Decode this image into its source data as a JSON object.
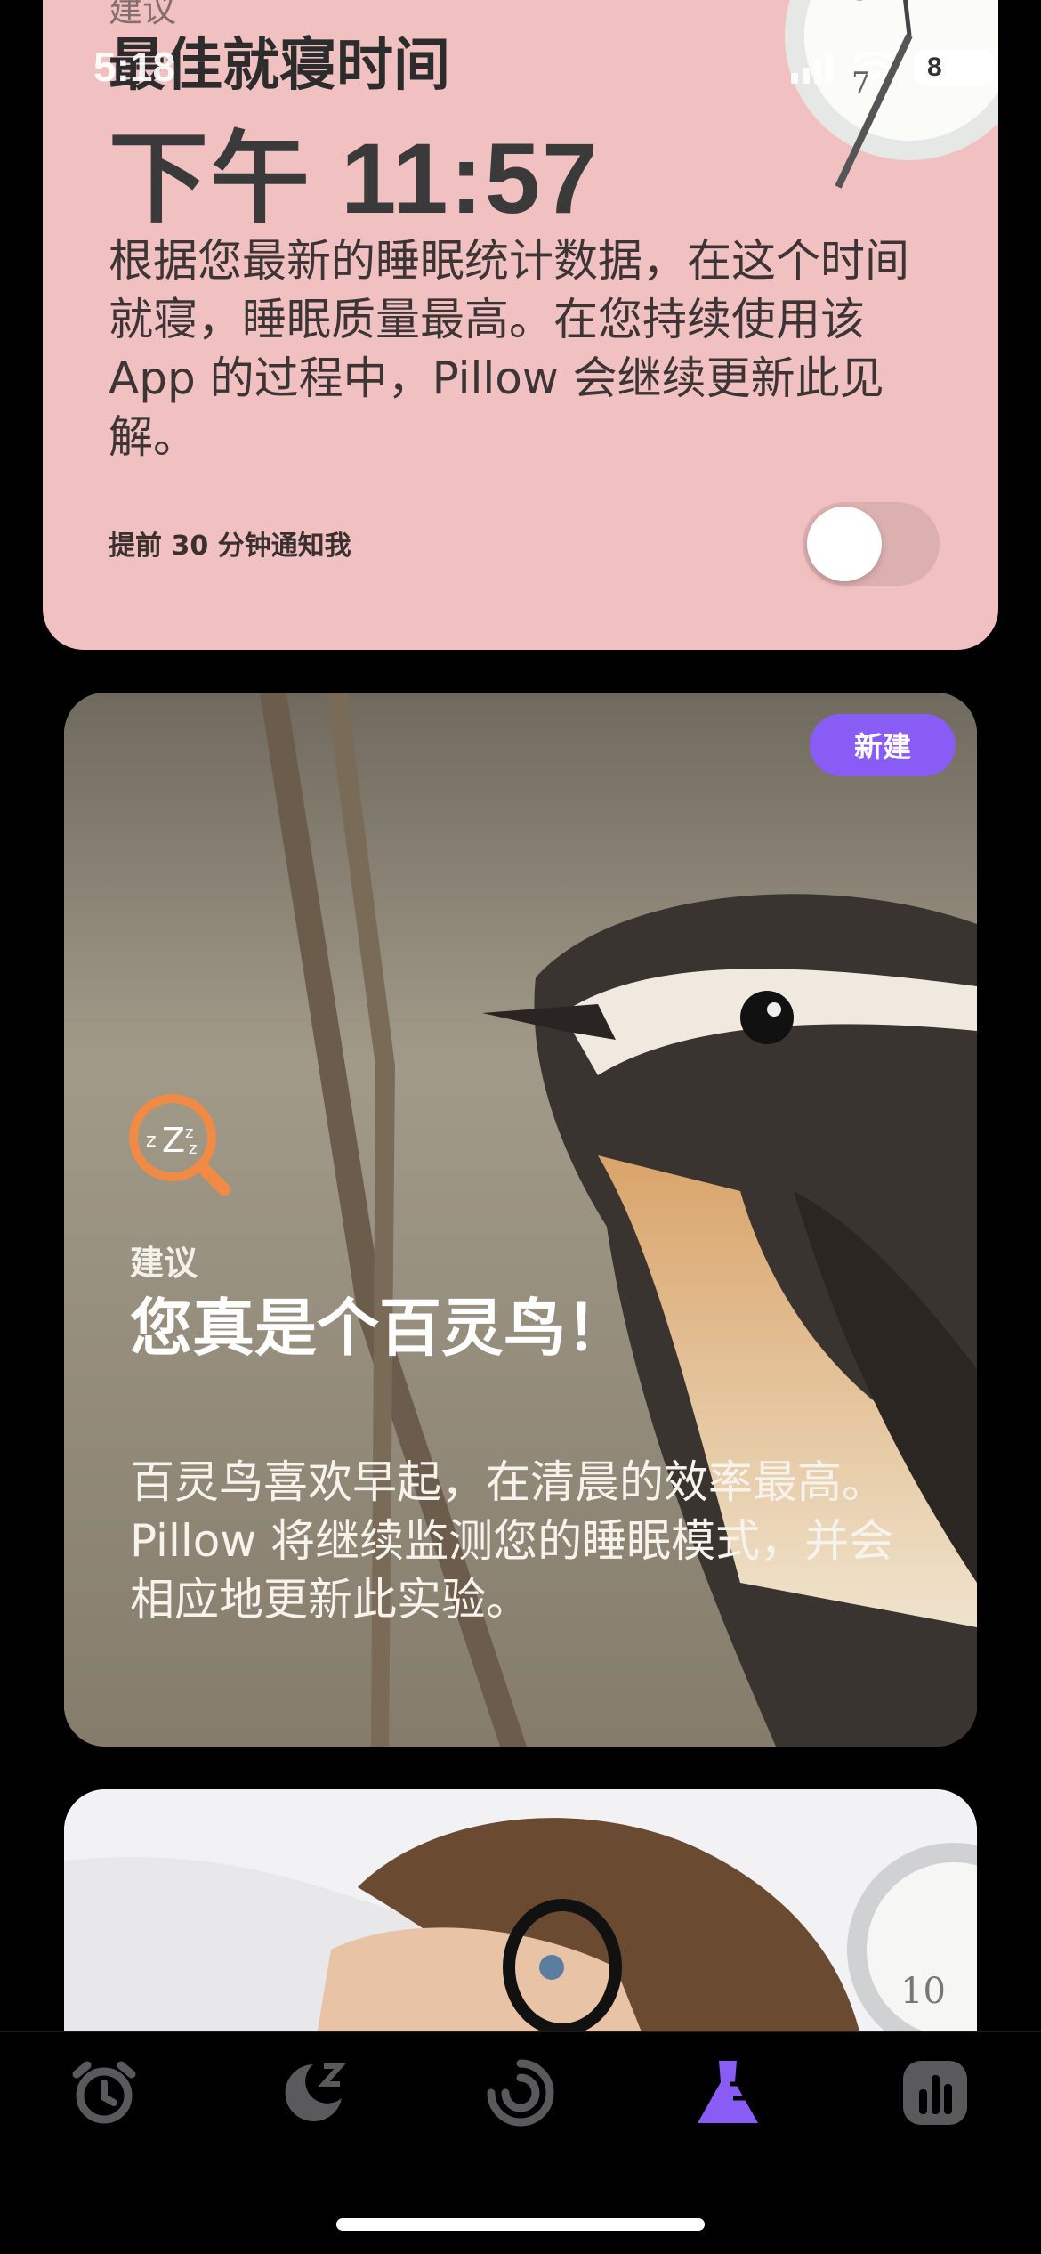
{
  "status": {
    "time": "5:18",
    "battery": "8"
  },
  "bedtime_card": {
    "eyebrow": "建议",
    "title": "最佳就寝时间",
    "time": "下午 11:57",
    "body": "根据您最新的睡眠统计数据，在这个时间就寝，睡眠质量最高。在您持续使用该 App 的过程中，Pillow 会继续更新此见解。",
    "notify_label": "提前 30 分钟通知我",
    "notify_enabled": false
  },
  "lark_card": {
    "badge": "新建",
    "icon": "sleep-search-icon",
    "eyebrow": "建议",
    "title": "您真是个百灵鸟！",
    "body": "百灵鸟喜欢早起，在清晨的效率最高。Pillow 将继续监测您的睡眠模式，并会相应地更新此实验。"
  },
  "tabs": [
    {
      "icon": "alarm-clock-icon",
      "active": false
    },
    {
      "icon": "moon-sleep-icon",
      "active": false
    },
    {
      "icon": "progress-ring-icon",
      "active": false
    },
    {
      "icon": "flask-icon",
      "active": true
    },
    {
      "icon": "stats-icon",
      "active": false
    }
  ],
  "colors": {
    "accent": "#8a5cf6",
    "card_pink": "#f1c1c1",
    "tab_inactive": "#5a5a5c"
  }
}
